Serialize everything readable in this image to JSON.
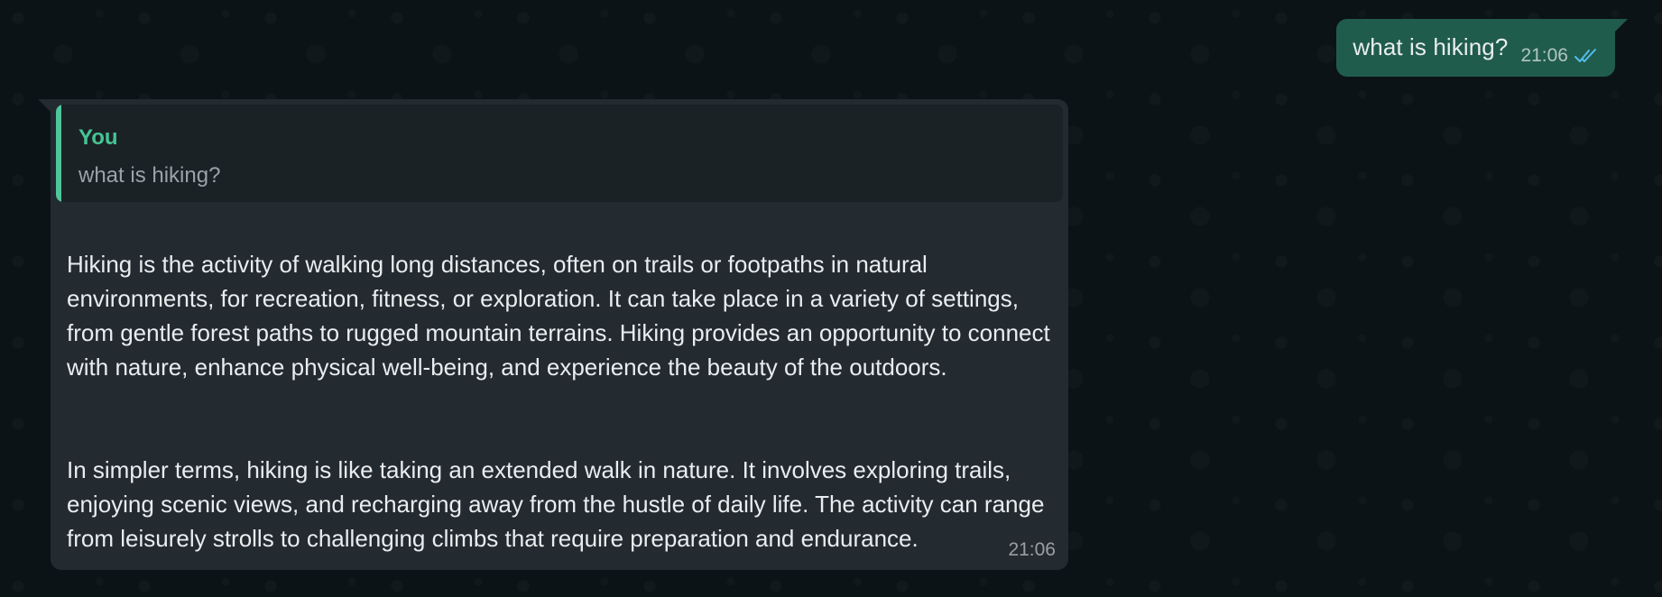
{
  "messages": {
    "outgoing": {
      "text": "what is hiking?",
      "time": "21:06",
      "status_icon": "double-check-read-icon"
    },
    "incoming": {
      "quote": {
        "author": "You",
        "text": "what is hiking?"
      },
      "paragraphs": [
        "Hiking is the activity of walking long distances, often on trails or footpaths in natural environments, for recreation, fitness, or exploration. It can take place in a variety of settings, from gentle forest paths to rugged mountain terrains. Hiking provides an opportunity to connect with nature, enhance physical well-being, and experience the beauty of the outdoors.",
        "In simpler terms, hiking is like taking an extended walk in nature. It involves exploring trails, enjoying scenic views, and recharging away from the hustle of daily life. The activity can range from leisurely strolls to challenging climbs that require preparation and endurance."
      ],
      "time": "21:06"
    }
  },
  "colors": {
    "background": "#0c1317",
    "outgoing_bubble": "#205c4c",
    "incoming_bubble": "#232a30",
    "quote_accent": "#4fc59a",
    "read_ticks": "#53bdeb"
  }
}
